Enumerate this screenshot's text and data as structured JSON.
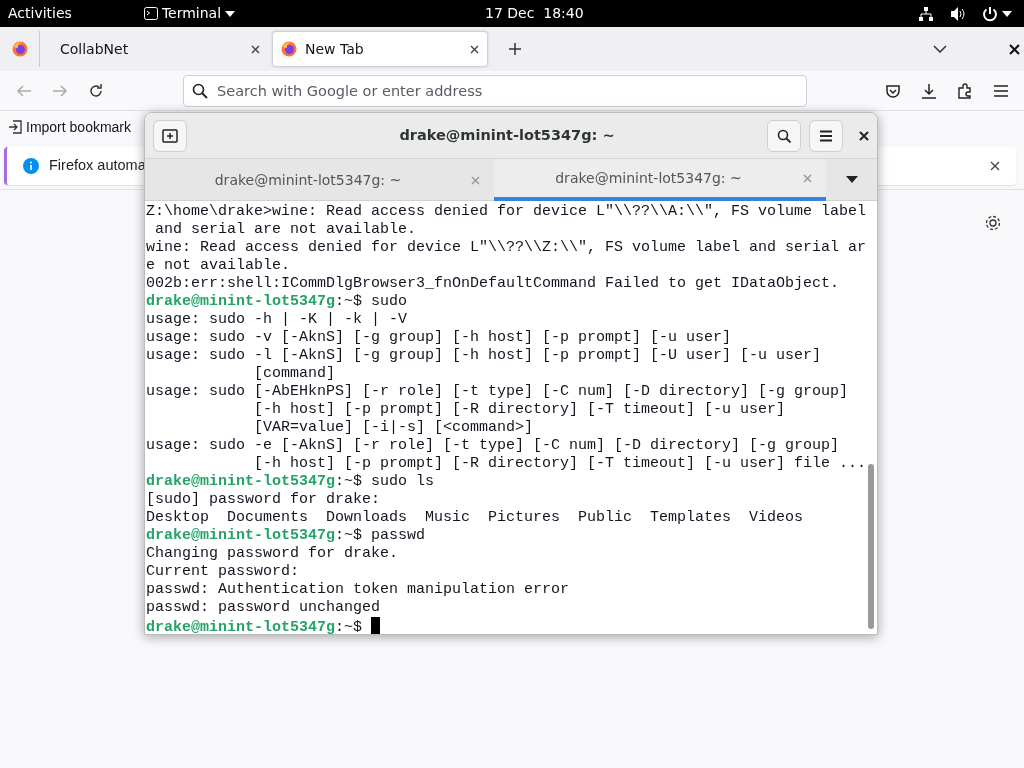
{
  "top_bar": {
    "activities": "Activities",
    "app_menu": "Terminal",
    "clock": "17 Dec  18:40"
  },
  "browser": {
    "tabs": [
      {
        "title": "CollabNet",
        "selected": false
      },
      {
        "title": "New Tab",
        "selected": true
      }
    ],
    "address_placeholder": "Search with Google or enter address",
    "bookmark": "Import bookmark",
    "notification": "Firefox automa"
  },
  "terminal": {
    "title": "drake@minint-lot5347g: ~",
    "tabs": [
      {
        "title": "drake@minint-lot5347g: ~",
        "selected": false
      },
      {
        "title": "drake@minint-lot5347g: ~",
        "selected": true
      }
    ],
    "lines": [
      {
        "kind": "output",
        "text": "Z:\\home\\drake>wine: Read access denied for device L\"\\\\??\\\\A:\\\\\", FS volume label"
      },
      {
        "kind": "output",
        "text": " and serial are not available."
      },
      {
        "kind": "output",
        "text": "wine: Read access denied for device L\"\\\\??\\\\Z:\\\\\", FS volume label and serial ar"
      },
      {
        "kind": "output",
        "text": "e not available."
      },
      {
        "kind": "output",
        "text": "002b:err:shell:ICommDlgBrowser3_fnOnDefaultCommand Failed to get IDataObject."
      },
      {
        "kind": "prompt",
        "user": "drake@minint-lot5347g",
        "path": ":~$",
        "command": "sudo"
      },
      {
        "kind": "output",
        "text": "usage: sudo -h | -K | -k | -V"
      },
      {
        "kind": "output",
        "text": "usage: sudo -v [-AknS] [-g group] [-h host] [-p prompt] [-u user]"
      },
      {
        "kind": "output",
        "text": "usage: sudo -l [-AknS] [-g group] [-h host] [-p prompt] [-U user] [-u user]"
      },
      {
        "kind": "output",
        "text": "            [command]"
      },
      {
        "kind": "output",
        "text": "usage: sudo [-AbEHknPS] [-r role] [-t type] [-C num] [-D directory] [-g group]"
      },
      {
        "kind": "output",
        "text": "            [-h host] [-p prompt] [-R directory] [-T timeout] [-u user]"
      },
      {
        "kind": "output",
        "text": "            [VAR=value] [-i|-s] [<command>]"
      },
      {
        "kind": "output",
        "text": "usage: sudo -e [-AknS] [-r role] [-t type] [-C num] [-D directory] [-g group]"
      },
      {
        "kind": "output",
        "text": "            [-h host] [-p prompt] [-R directory] [-T timeout] [-u user] file ..."
      },
      {
        "kind": "prompt",
        "user": "drake@minint-lot5347g",
        "path": ":~$",
        "command": "sudo ls"
      },
      {
        "kind": "output",
        "text": "[sudo] password for drake:"
      },
      {
        "kind": "output",
        "text": "Desktop  Documents  Downloads  Music  Pictures  Public  Templates  Videos"
      },
      {
        "kind": "prompt",
        "user": "drake@minint-lot5347g",
        "path": ":~$",
        "command": "passwd"
      },
      {
        "kind": "output",
        "text": "Changing password for drake."
      },
      {
        "kind": "output",
        "text": "Current password:"
      },
      {
        "kind": "output",
        "text": "passwd: Authentication token manipulation error"
      },
      {
        "kind": "output",
        "text": "passwd: password unchanged"
      },
      {
        "kind": "prompt",
        "user": "drake@minint-lot5347g",
        "path": ":~$",
        "cursor": true
      }
    ]
  }
}
